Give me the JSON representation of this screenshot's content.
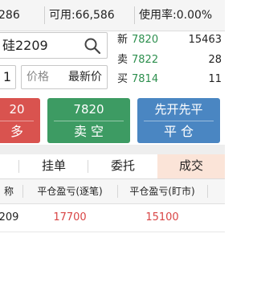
{
  "account_bar": {
    "balance_partial": "286",
    "available": "可用:66,586",
    "usage": "使用率:0.00%"
  },
  "order_form": {
    "contract": "硅2209",
    "quantity": "1",
    "price_label": "价格",
    "price_value": "最新价"
  },
  "quote": {
    "rows": [
      {
        "key": "新",
        "price": "7820",
        "volume": "15463"
      },
      {
        "key": "卖",
        "price": "7822",
        "volume": "28"
      },
      {
        "key": "买",
        "price": "7814",
        "volume": "11"
      }
    ]
  },
  "buttons": {
    "buy": {
      "price": "20",
      "label": "多"
    },
    "sell": {
      "price": "7820",
      "label": "卖 空"
    },
    "close": {
      "price": "先开先平",
      "label": "平 仓"
    }
  },
  "tabs": [
    "挂单",
    "委托",
    "成交"
  ],
  "active_tab": "成交",
  "fills_table": {
    "headers": [
      "称",
      "平仓盈亏(逐笔)",
      "平仓盈亏(盯市)"
    ],
    "rows": [
      {
        "name": "209",
        "pnl_trade": "17700",
        "pnl_mark": "15100"
      }
    ]
  },
  "colors": {
    "buy": "#d9534f",
    "sell": "#3d9b63",
    "close": "#4a86c2",
    "price_green": "#2d8f4e",
    "pnl_red": "#d94545"
  },
  "icons": {
    "search": "search-icon"
  }
}
